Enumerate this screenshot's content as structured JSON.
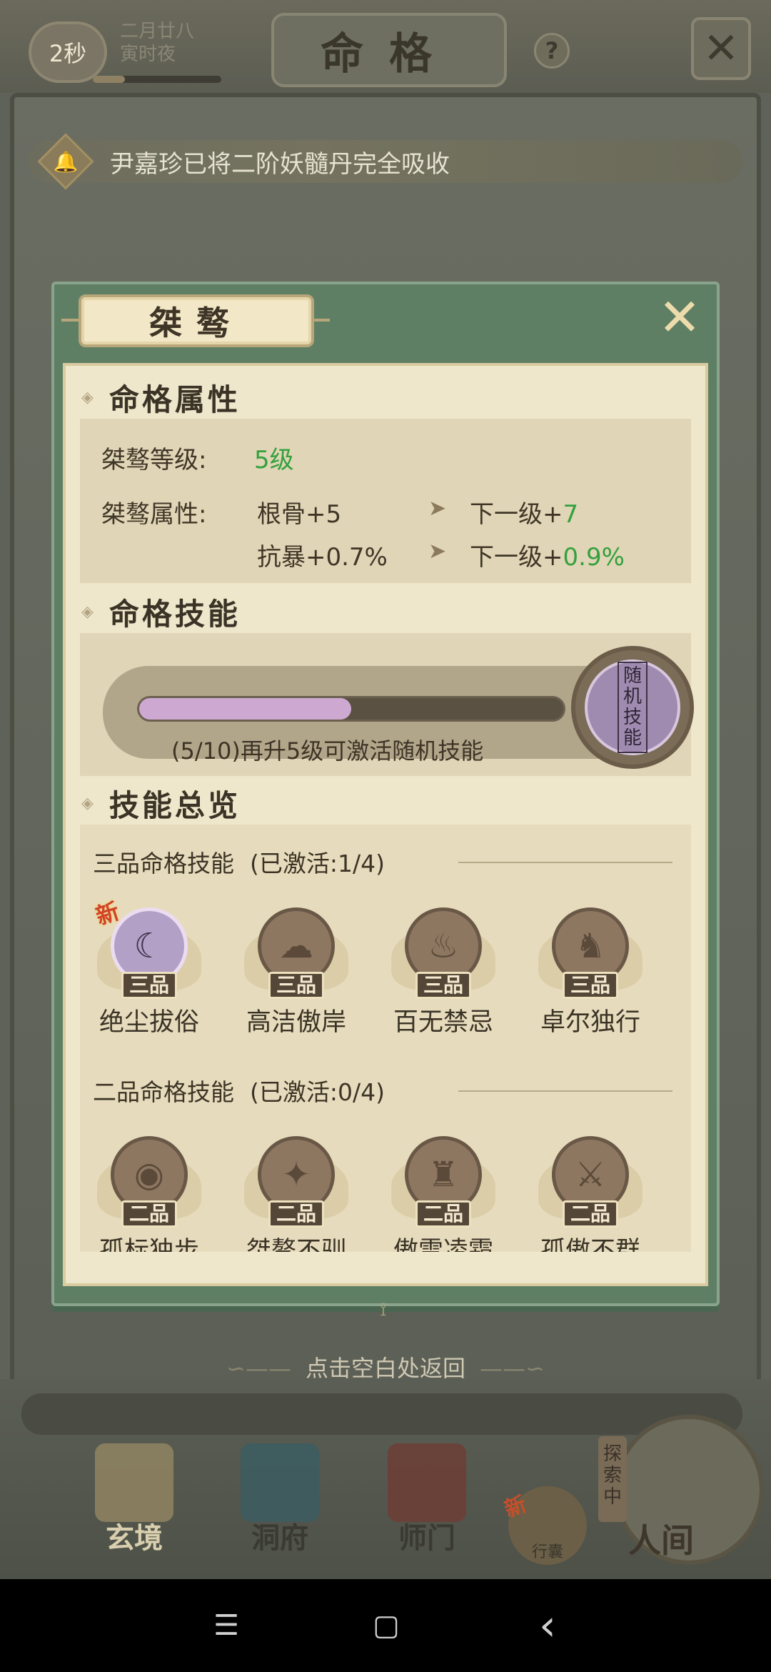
{
  "top_bar": {
    "timer": "2秒",
    "lunar_date": "二月廿八",
    "time_of_day": "寅时夜",
    "title": "命格",
    "help": "?",
    "close": "✕"
  },
  "notice": {
    "icon": "bell-icon",
    "text": "尹嘉珍已将二阶妖髓丹完全吸收"
  },
  "panel": {
    "tab_title": "桀骜",
    "close": "✕",
    "attributes": {
      "header": "命格属性",
      "level_label": "桀骜等级:",
      "level_value": "5级",
      "attr_label": "桀骜属性:",
      "rows": [
        {
          "current": "根骨+5",
          "next_label": "下一级+",
          "next_value": "7"
        },
        {
          "current": "抗暴+0.7%",
          "next_label": "下一级+",
          "next_value": "0.9%"
        }
      ]
    },
    "skill": {
      "header": "命格技能",
      "progress_fraction": 0.5,
      "progress_text": "(5/10)再升5级可激活随机技能",
      "random_skill_label": "随机技能"
    },
    "overview": {
      "header": "技能总览",
      "tiers": [
        {
          "title": "三品命格技能",
          "count": "(已激活:1/4)",
          "rank": "三品",
          "skills": [
            {
              "name": "绝尘拔俗",
              "active": true,
              "new": "新",
              "icon": "moon-spirit-icon"
            },
            {
              "name": "高洁傲岸",
              "active": false,
              "icon": "cloud-swirl-icon"
            },
            {
              "name": "百无禁忌",
              "active": false,
              "icon": "flame-beast-icon"
            },
            {
              "name": "卓尔独行",
              "active": false,
              "icon": "wolf-icon"
            }
          ]
        },
        {
          "title": "二品命格技能",
          "count": "(已激活:0/4)",
          "rank": "二品",
          "skills": [
            {
              "name": "孤标独步",
              "active": false,
              "icon": "eye-icon"
            },
            {
              "name": "桀骜不驯",
              "active": false,
              "icon": "bird-icon"
            },
            {
              "name": "傲雪凌霜",
              "active": false,
              "icon": "warrior-icon"
            },
            {
              "name": "孤傲不群",
              "active": false,
              "icon": "swordsman-icon"
            }
          ]
        }
      ]
    }
  },
  "return_hint": "点击空白处返回",
  "bottom_nav": {
    "tabs": [
      {
        "label": "玄境"
      },
      {
        "label": "洞府"
      },
      {
        "label": "师门"
      }
    ],
    "xingnang": {
      "label": "行囊",
      "badge": "新"
    },
    "renjian": {
      "label": "人间",
      "tag": "探索中"
    }
  },
  "system_nav": {
    "menu": "☰",
    "home": "▢",
    "back": "‹"
  }
}
